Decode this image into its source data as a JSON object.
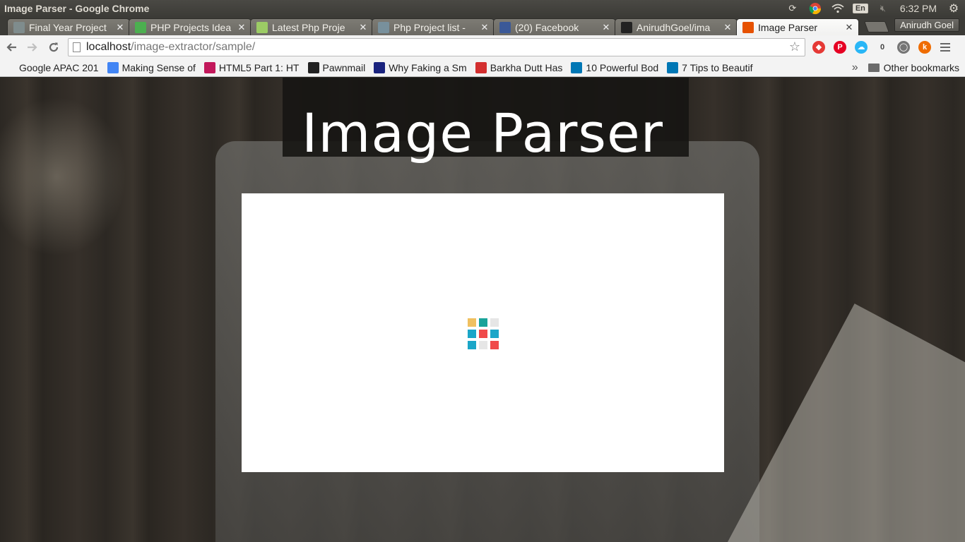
{
  "os": {
    "window_title": "Image Parser - Google Chrome",
    "language": "En",
    "clock": "6:32 PM"
  },
  "tabs": [
    {
      "label": "Final Year Project",
      "favicon": "page-icon",
      "color": "#7f8c8d",
      "active": false
    },
    {
      "label": "PHP Projects Idea",
      "favicon": "php-icon",
      "color": "#4caf50",
      "active": false
    },
    {
      "label": "Latest Php Proje",
      "favicon": "zz-icon",
      "color": "#9ccc65",
      "active": false
    },
    {
      "label": "Php Project list -",
      "favicon": "globe-icon",
      "color": "#78909c",
      "active": false
    },
    {
      "label": "(20) Facebook",
      "favicon": "facebook-icon",
      "color": "#3b5998",
      "active": false
    },
    {
      "label": "AnirudhGoel/ima",
      "favicon": "github-icon",
      "color": "#222222",
      "active": false
    },
    {
      "label": "Image Parser",
      "favicon": "image-parser-icon",
      "color": "#e65100",
      "active": true
    }
  ],
  "profile_name": "Anirudh Goel",
  "url": {
    "host": "localhost",
    "path": "/image-extractor/sample/"
  },
  "extensions": [
    {
      "name": "ublock-icon",
      "color": "#e53935",
      "glyph": "◆"
    },
    {
      "name": "pinterest-icon",
      "color": "#e60023",
      "glyph": "P"
    },
    {
      "name": "cloud-icon",
      "color": "#29b6f6",
      "glyph": "☁"
    },
    {
      "name": "counter-badge-icon",
      "color": "#f3f3f3",
      "glyph": "0"
    },
    {
      "name": "circle-extension-icon",
      "color": "#757575",
      "glyph": "◯"
    },
    {
      "name": "k-extension-icon",
      "color": "#ef6c00",
      "glyph": "k"
    }
  ],
  "bookmarks": [
    {
      "label": "Google APAC 201",
      "icon": "blank-icon",
      "color": "transparent"
    },
    {
      "label": "Making Sense of",
      "icon": "google-icon",
      "color": "#4285f4"
    },
    {
      "label": "HTML5 Part 1: HT",
      "icon": "puzzle-icon",
      "color": "#c2185b"
    },
    {
      "label": "Pawnmail",
      "icon": "pawn-icon",
      "color": "#222222"
    },
    {
      "label": "Why Faking a Sm",
      "icon": "f-icon",
      "color": "#1a237e"
    },
    {
      "label": "Barkha Dutt Has",
      "icon": "news-icon",
      "color": "#d32f2f"
    },
    {
      "label": "10 Powerful Bod",
      "icon": "linkedin-icon",
      "color": "#0077b5"
    },
    {
      "label": "7 Tips to Beautif",
      "icon": "linkedin-icon",
      "color": "#0077b5"
    }
  ],
  "bookmarks_more": "»",
  "other_bookmarks": "Other bookmarks",
  "page": {
    "heading": "Image Parser",
    "loader_colors": [
      "#f0c060",
      "#1aa39a",
      "#e6e6e6",
      "#1ba6c8",
      "#f04a4a",
      "#1ba6c8",
      "#1ba6c8",
      "#e6e6e6",
      "#f04a4a"
    ]
  }
}
